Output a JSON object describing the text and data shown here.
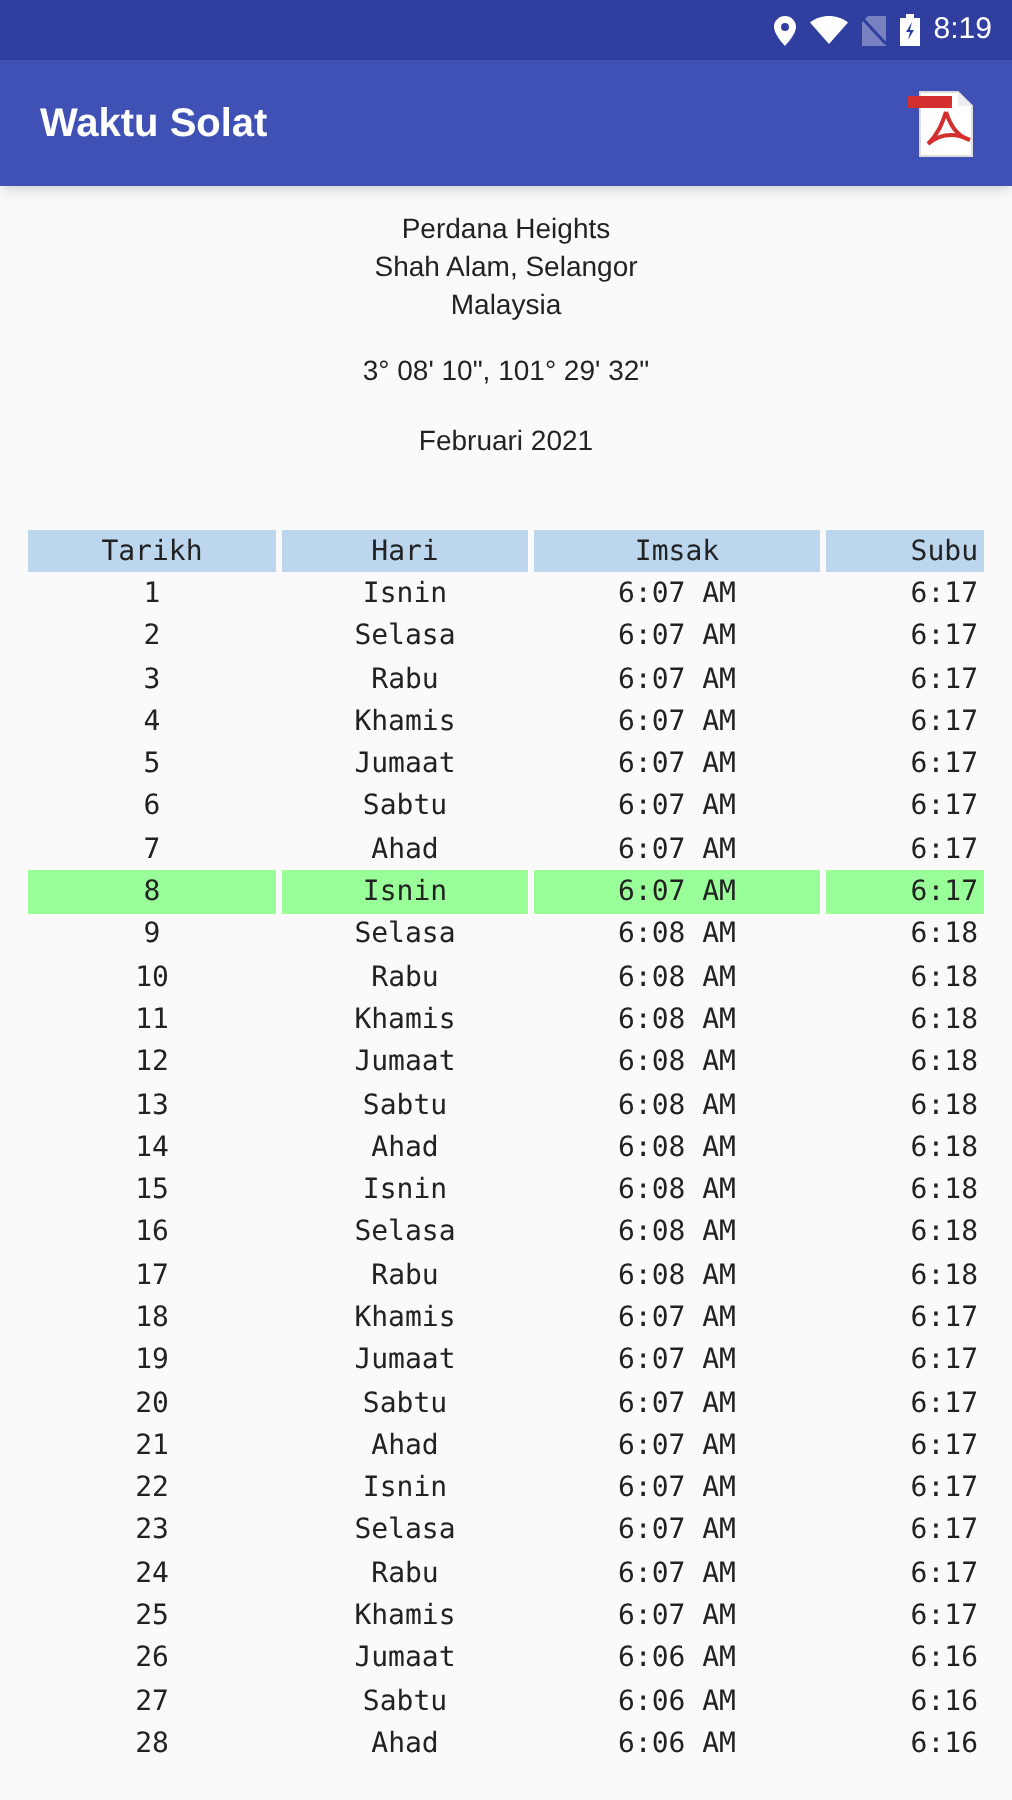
{
  "status_bar": {
    "time": "8:19"
  },
  "app_bar": {
    "title": "Waktu Solat"
  },
  "location": {
    "lines": [
      "Perdana Heights",
      "Shah Alam, Selangor",
      "Malaysia"
    ],
    "coordinates": "3° 08' 10\", 101° 29' 32\"",
    "month": "Februari 2021"
  },
  "table": {
    "columns": [
      "Tarikh",
      "Hari",
      "Imsak",
      "Subu"
    ],
    "rows": [
      {
        "cells": [
          "1",
          "Isnin",
          "6:07 AM",
          "6:17"
        ],
        "selected": false
      },
      {
        "cells": [
          "2",
          "Selasa",
          "6:07 AM",
          "6:17"
        ],
        "selected": false
      },
      {
        "cells": [
          "3",
          "Rabu",
          "6:07 AM",
          "6:17"
        ],
        "selected": false
      },
      {
        "cells": [
          "4",
          "Khamis",
          "6:07 AM",
          "6:17"
        ],
        "selected": false
      },
      {
        "cells": [
          "5",
          "Jumaat",
          "6:07 AM",
          "6:17"
        ],
        "selected": false
      },
      {
        "cells": [
          "6",
          "Sabtu",
          "6:07 AM",
          "6:17"
        ],
        "selected": false
      },
      {
        "cells": [
          "7",
          "Ahad",
          "6:07 AM",
          "6:17"
        ],
        "selected": false
      },
      {
        "cells": [
          "8",
          "Isnin",
          "6:07 AM",
          "6:17"
        ],
        "selected": true
      },
      {
        "cells": [
          "9",
          "Selasa",
          "6:08 AM",
          "6:18"
        ],
        "selected": false
      },
      {
        "cells": [
          "10",
          "Rabu",
          "6:08 AM",
          "6:18"
        ],
        "selected": false
      },
      {
        "cells": [
          "11",
          "Khamis",
          "6:08 AM",
          "6:18"
        ],
        "selected": false
      },
      {
        "cells": [
          "12",
          "Jumaat",
          "6:08 AM",
          "6:18"
        ],
        "selected": false
      },
      {
        "cells": [
          "13",
          "Sabtu",
          "6:08 AM",
          "6:18"
        ],
        "selected": false
      },
      {
        "cells": [
          "14",
          "Ahad",
          "6:08 AM",
          "6:18"
        ],
        "selected": false
      },
      {
        "cells": [
          "15",
          "Isnin",
          "6:08 AM",
          "6:18"
        ],
        "selected": false
      },
      {
        "cells": [
          "16",
          "Selasa",
          "6:08 AM",
          "6:18"
        ],
        "selected": false
      },
      {
        "cells": [
          "17",
          "Rabu",
          "6:08 AM",
          "6:18"
        ],
        "selected": false
      },
      {
        "cells": [
          "18",
          "Khamis",
          "6:07 AM",
          "6:17"
        ],
        "selected": false
      },
      {
        "cells": [
          "19",
          "Jumaat",
          "6:07 AM",
          "6:17"
        ],
        "selected": false
      },
      {
        "cells": [
          "20",
          "Sabtu",
          "6:07 AM",
          "6:17"
        ],
        "selected": false
      },
      {
        "cells": [
          "21",
          "Ahad",
          "6:07 AM",
          "6:17"
        ],
        "selected": false
      },
      {
        "cells": [
          "22",
          "Isnin",
          "6:07 AM",
          "6:17"
        ],
        "selected": false
      },
      {
        "cells": [
          "23",
          "Selasa",
          "6:07 AM",
          "6:17"
        ],
        "selected": false
      },
      {
        "cells": [
          "24",
          "Rabu",
          "6:07 AM",
          "6:17"
        ],
        "selected": false
      },
      {
        "cells": [
          "25",
          "Khamis",
          "6:07 AM",
          "6:17"
        ],
        "selected": false
      },
      {
        "cells": [
          "26",
          "Jumaat",
          "6:06 AM",
          "6:16"
        ],
        "selected": false
      },
      {
        "cells": [
          "27",
          "Sabtu",
          "6:06 AM",
          "6:16"
        ],
        "selected": false
      },
      {
        "cells": [
          "28",
          "Ahad",
          "6:06 AM",
          "6:16"
        ],
        "selected": false
      }
    ]
  }
}
